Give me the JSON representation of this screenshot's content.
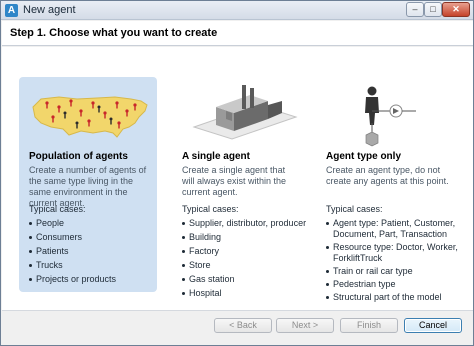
{
  "window": {
    "title": "New agent",
    "controls": {
      "minimize": "–",
      "maximize": "□",
      "close": "✕"
    }
  },
  "header": {
    "step_title": "Step 1. Choose what you want to create"
  },
  "options": [
    {
      "title": "Population of agents",
      "description": "Create a number of agents of the same type living in the same environment in the current agent.",
      "cases_label": "Typical cases:",
      "cases": [
        "People",
        "Consumers",
        "Patients",
        "Trucks",
        "Projects or products"
      ],
      "selected": true,
      "illustration": "usa-map-with-people-icon"
    },
    {
      "title": "A single agent",
      "description": "Create a single agent that will always exist within the current agent.",
      "cases_label": "Typical cases:",
      "cases": [
        "Supplier, distributor, producer",
        "Building",
        "Factory",
        "Store",
        "Gas station",
        "Hospital"
      ],
      "selected": false,
      "illustration": "factory-building-icon"
    },
    {
      "title": "Agent type only",
      "description": "Create an agent type, do not create any agents at this point.",
      "cases_label": "Typical cases:",
      "cases": [
        "Agent type: Patient, Customer, Document, Part, Transaction",
        "Resource type: Doctor, Worker, ForkliftTruck",
        "Train or rail car type",
        "Pedestrian type",
        "Structural part of the model"
      ],
      "selected": false,
      "illustration": "agent-type-flow-icon"
    }
  ],
  "footer": {
    "back_label": "< Back",
    "next_label": "Next >",
    "finish_label": "Finish",
    "cancel_label": "Cancel"
  },
  "colors": {
    "selected_card": "#cfe0f2",
    "title_bar": "#d4dce7",
    "map_fill": "#f2d66b"
  }
}
